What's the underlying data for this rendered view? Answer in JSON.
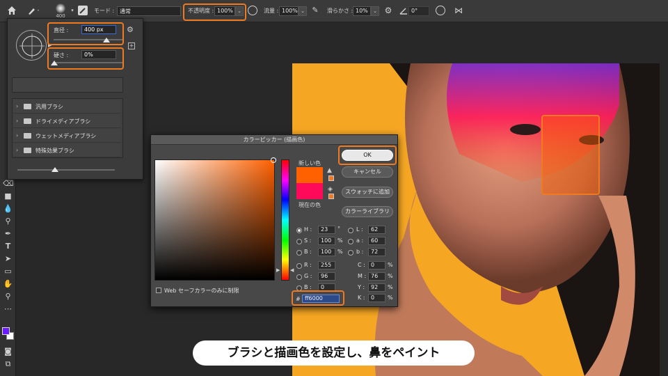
{
  "options_bar": {
    "brush_size": "400",
    "mode_label": "モード :",
    "mode_value": "通常",
    "opacity_label": "不透明度 :",
    "opacity_value": "100%",
    "flow_label": "流量 :",
    "flow_value": "100%",
    "smoothing_label": "滑らかさ :",
    "smoothing_value": "10%",
    "angle_value": "0°"
  },
  "brush_panel": {
    "diameter_label": "直径 :",
    "diameter_value": "400 px",
    "hardness_label": "硬さ :",
    "hardness_value": "0%",
    "folders": [
      {
        "label": "汎用ブラシ"
      },
      {
        "label": "ドライメディアブラシ"
      },
      {
        "label": "ウェットメディアブラシ"
      },
      {
        "label": "特殊効果ブラシ"
      }
    ]
  },
  "color_picker": {
    "title": "カラーピッカー (描画色)",
    "new_label": "新しい色",
    "current_label": "現在の色",
    "new_color": "#ff6000",
    "current_color": "#ff0a5a",
    "ok_label": "OK",
    "cancel_label": "キャンセル",
    "add_swatch_label": "スウォッチに追加",
    "library_label": "カラーライブラリ",
    "hsb": {
      "h_label": "H :",
      "h": "23",
      "h_unit": "°",
      "s_label": "S :",
      "s": "100",
      "s_unit": "%",
      "b_label": "B :",
      "b": "100",
      "b_unit": "%"
    },
    "rgb": {
      "r_label": "R :",
      "r": "255",
      "g_label": "G :",
      "g": "96",
      "b_label": "B :",
      "b": "0"
    },
    "lab": {
      "l_label": "L :",
      "l": "62",
      "a_label": "a :",
      "a": "60",
      "b_label": "b :",
      "b": "72"
    },
    "cmyk": {
      "c_label": "C :",
      "c": "0",
      "m_label": "M :",
      "m": "76",
      "y_label": "Y :",
      "y": "92",
      "k_label": "K :",
      "k": "0",
      "unit": "%"
    },
    "hex_label": "#",
    "hex": "ff6000",
    "web_safe_label": "Web セーフカラーのみに制限"
  },
  "caption": "ブラシと描画色を設定し、鼻をペイント",
  "colors": {
    "highlight": "#f07a20",
    "foreground": "#6a1aff",
    "background": "#ffffff"
  }
}
